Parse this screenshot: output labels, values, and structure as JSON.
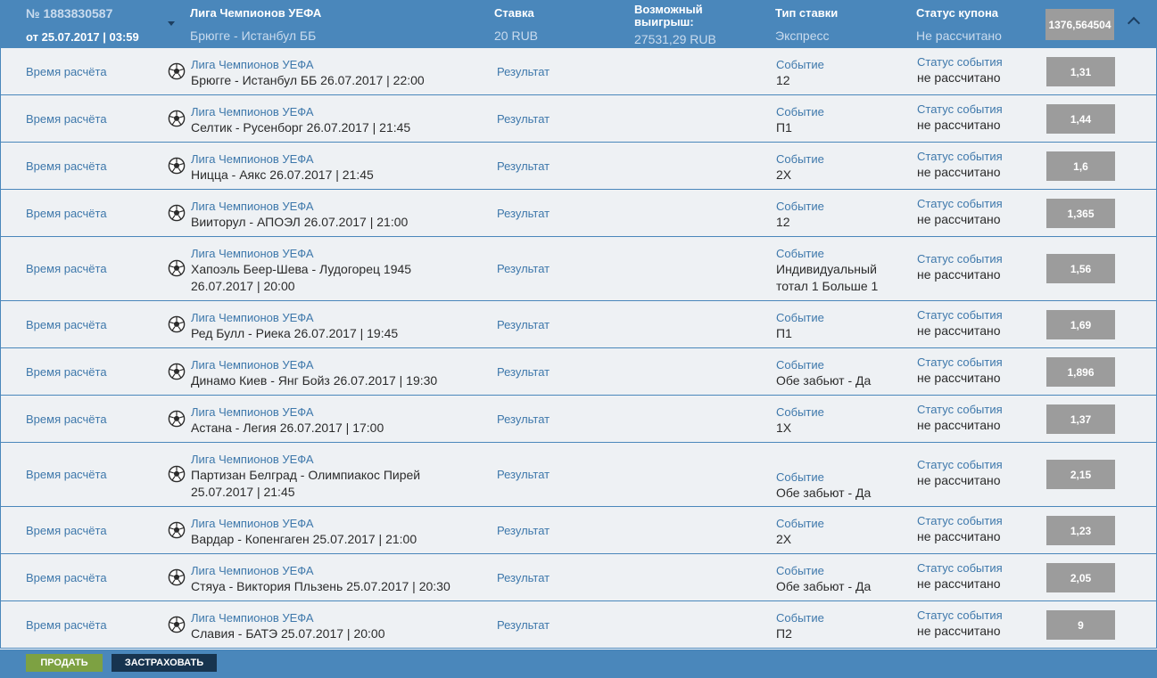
{
  "coupon": {
    "number": "№ 1883830587",
    "date": "от 25.07.2017 | 03:59",
    "tournament": "Лига Чемпионов УЕФА",
    "match": "Брюгге - Истанбул ББ",
    "stake_label": "Ставка",
    "stake_value": "20 RUB",
    "win_label_1": "Возможный",
    "win_label_2": "выигрыш:",
    "win_value": "27531,29 RUB",
    "bet_type_label": "Тип ставки",
    "bet_type_value": "Экспресс",
    "status_label": "Статус купона",
    "status_value": "Не рассчитано",
    "total_odds": "1376,564504"
  },
  "row_labels": {
    "calc_time": "Время расчёта",
    "result": "Результат",
    "event": "Событие",
    "event_status": "Статус события"
  },
  "events": [
    {
      "tournament": "Лига Чемпионов УЕФА",
      "lines": [
        "Брюгге - Истанбул ББ 26.07.2017 | 22:00"
      ],
      "event_lines": [
        "12"
      ],
      "status": "не рассчитано",
      "odds": "1,31"
    },
    {
      "tournament": "Лига Чемпионов УЕФА",
      "lines": [
        "Селтик - Русенборг 26.07.2017 | 21:45"
      ],
      "event_lines": [
        "П1"
      ],
      "status": "не рассчитано",
      "odds": "1,44"
    },
    {
      "tournament": "Лига Чемпионов УЕФА",
      "lines": [
        "Ницца - Аякс 26.07.2017 | 21:45"
      ],
      "event_lines": [
        "2Х"
      ],
      "status": "не рассчитано",
      "odds": "1,6"
    },
    {
      "tournament": "Лига Чемпионов УЕФА",
      "lines": [
        "Вииторул - АПОЭЛ 26.07.2017 | 21:00"
      ],
      "event_lines": [
        "12"
      ],
      "status": "не рассчитано",
      "odds": "1,365"
    },
    {
      "tournament": "Лига Чемпионов УЕФА",
      "lines": [
        "Хапоэль Беер-Шева - Лудогорец 1945",
        "26.07.2017 | 20:00"
      ],
      "event_lines": [
        "Индивидуальный",
        "тотал 1 Больше 1"
      ],
      "status": "не рассчитано",
      "odds": "1,56"
    },
    {
      "tournament": "Лига Чемпионов УЕФА",
      "lines": [
        "Ред Булл - Риека 26.07.2017 | 19:45"
      ],
      "event_lines": [
        "П1"
      ],
      "status": "не рассчитано",
      "odds": "1,69"
    },
    {
      "tournament": "Лига Чемпионов УЕФА",
      "lines": [
        "Динамо Киев - Янг Бойз 26.07.2017 | 19:30"
      ],
      "event_lines": [
        "Обе забьют - Да"
      ],
      "status": "не рассчитано",
      "odds": "1,896"
    },
    {
      "tournament": "Лига Чемпионов УЕФА",
      "lines": [
        "Астана - Легия 26.07.2017 | 17:00"
      ],
      "event_lines": [
        "1Х"
      ],
      "status": "не рассчитано",
      "odds": "1,37"
    },
    {
      "tournament": "Лига Чемпионов УЕФА",
      "lines": [
        "Партизан Белград - Олимпиакос Пирей",
        "25.07.2017 | 21:45"
      ],
      "event_lines": [
        "Обе забьют - Да"
      ],
      "status": "не рассчитано",
      "odds": "2,15"
    },
    {
      "tournament": "Лига Чемпионов УЕФА",
      "lines": [
        "Вардар - Копенгаген 25.07.2017 | 21:00"
      ],
      "event_lines": [
        "2Х"
      ],
      "status": "не рассчитано",
      "odds": "1,23"
    },
    {
      "tournament": "Лига Чемпионов УЕФА",
      "lines": [
        "Стяуа - Виктория Пльзень 25.07.2017 | 20:30"
      ],
      "event_lines": [
        "Обе забьют - Да"
      ],
      "status": "не рассчитано",
      "odds": "2,05"
    },
    {
      "tournament": "Лига Чемпионов УЕФА",
      "lines": [
        "Славия - БАТЭ 25.07.2017 | 20:00"
      ],
      "event_lines": [
        "П2"
      ],
      "status": "не рассчитано",
      "odds": "9"
    }
  ],
  "footer": {
    "sell_label": "ПРОДАТЬ",
    "insure_label": "ЗАСТРАХОВАТЬ"
  },
  "colors": {
    "header_bg": "#4a87bb",
    "row_bg": "#eef1f4",
    "link": "#3e78ab",
    "odds_bg": "#9c9c9c",
    "sell_btn": "#7da142",
    "insure_btn": "#17344f"
  },
  "icons": {
    "event_icon": "soccer-ball-icon",
    "collapse_icon": "chevron-up-icon",
    "dropdown_icon": "caret-down-icon"
  }
}
